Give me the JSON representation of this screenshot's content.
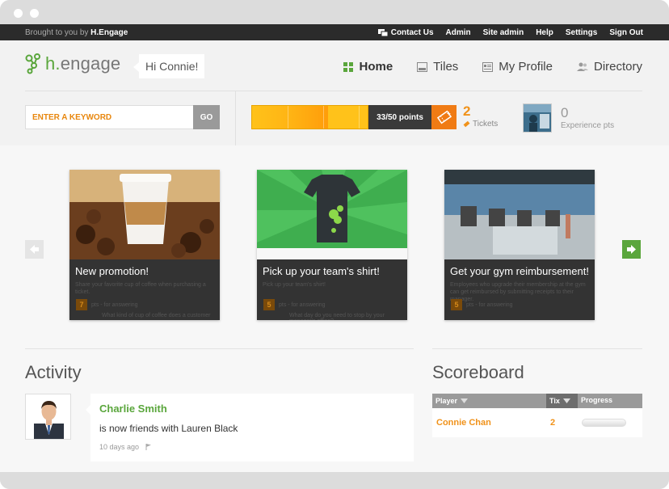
{
  "topbar": {
    "brought_prefix": "Brought to you by",
    "brought_brand": "H.Engage",
    "links": [
      "Contact Us",
      "Admin",
      "Site admin",
      "Help",
      "Settings",
      "Sign Out"
    ]
  },
  "header": {
    "logo_text_h": "h.",
    "logo_text_rest": "engage",
    "greeting": "Hi Connie!",
    "nav": [
      {
        "label": "Home",
        "icon": "grid-icon",
        "active": true
      },
      {
        "label": "Tiles",
        "icon": "tile-icon",
        "active": false
      },
      {
        "label": "My Profile",
        "icon": "profile-icon",
        "active": false
      },
      {
        "label": "Directory",
        "icon": "users-icon",
        "active": false
      }
    ]
  },
  "search": {
    "placeholder": "ENTER A KEYWORD",
    "button": "GO"
  },
  "points": {
    "label": "33/50 points",
    "current": 33,
    "max": 50
  },
  "tickets": {
    "count": "2",
    "label": "Tickets"
  },
  "experience": {
    "count": "0",
    "label": "Experience pts"
  },
  "carousel": {
    "cards": [
      {
        "title": "New promotion!",
        "desc": "Share your favorite cup of coffee when purchasing a ticket.",
        "num": "7",
        "meta": "pts - for answering",
        "question": "What kind of cup of coffee does a customer"
      },
      {
        "title": "Pick up your team's shirt!",
        "desc": "Pick up your team's shirt!",
        "num": "5",
        "meta": "pts - for answering",
        "question": "What day do you need to stop by your manager's office?"
      },
      {
        "title": "Get your gym reimbursement!",
        "desc": "Employees who upgrade their membership at the gym can get reimbursed by submitting receipts to their manager.",
        "num": "5",
        "meta": "pts - for answering",
        "question": ""
      }
    ]
  },
  "activity": {
    "title": "Activity",
    "items": [
      {
        "name": "Charlie Smith",
        "text": "is now friends with Lauren Black",
        "time": "10 days ago"
      }
    ]
  },
  "scoreboard": {
    "title": "Scoreboard",
    "headers": [
      "Player",
      "Tix",
      "Progress"
    ],
    "rows": [
      {
        "player": "Connie Chan",
        "tix": "2"
      }
    ]
  },
  "colors": {
    "accent_green": "#5aa63c",
    "accent_orange": "#f0921a",
    "dark_bar": "#2b2b2b"
  }
}
